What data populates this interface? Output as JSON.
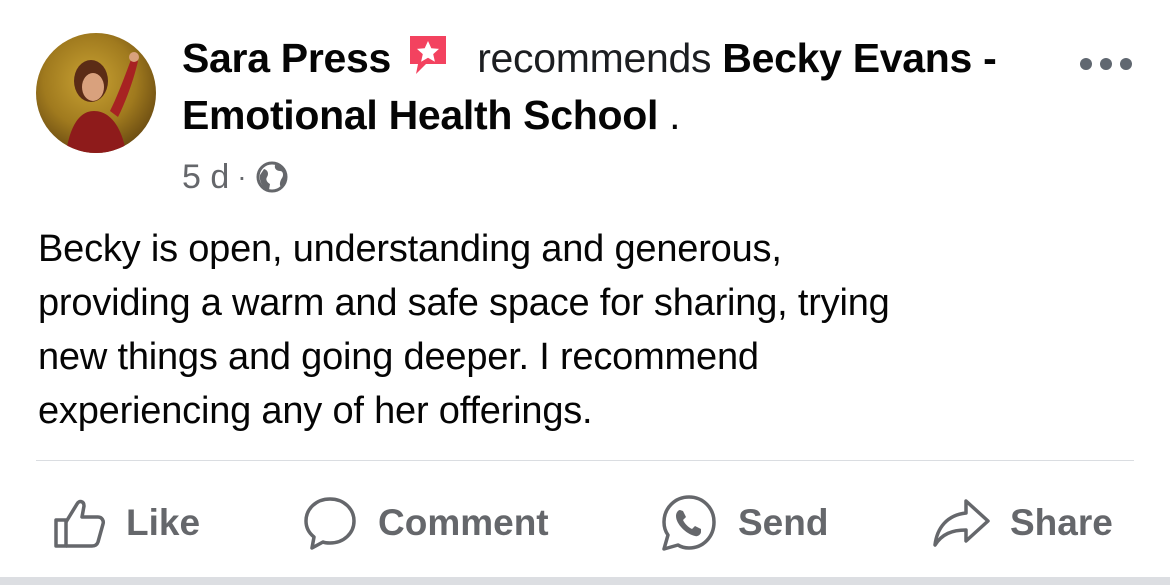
{
  "post": {
    "author": "Sara Press",
    "verb": "recommends",
    "page_name": "Becky Evans - Emotional Health School",
    "page_suffix": " .",
    "time": "5 d",
    "meta_separator": "·",
    "audience_icon": "globe-icon",
    "more_icon": "more-options-icon",
    "body": "Becky is open, understanding and generous,\nproviding a warm and safe space for sharing, trying\nnew things and going deeper.  I recommend\nexperiencing any of her offerings."
  },
  "actions": {
    "like": "Like",
    "comment": "Comment",
    "send": "Send",
    "share": "Share"
  },
  "colors": {
    "text": "#050505",
    "secondary": "#65676b",
    "recommend_badge": "#f3425f",
    "divider": "#dadde1"
  }
}
